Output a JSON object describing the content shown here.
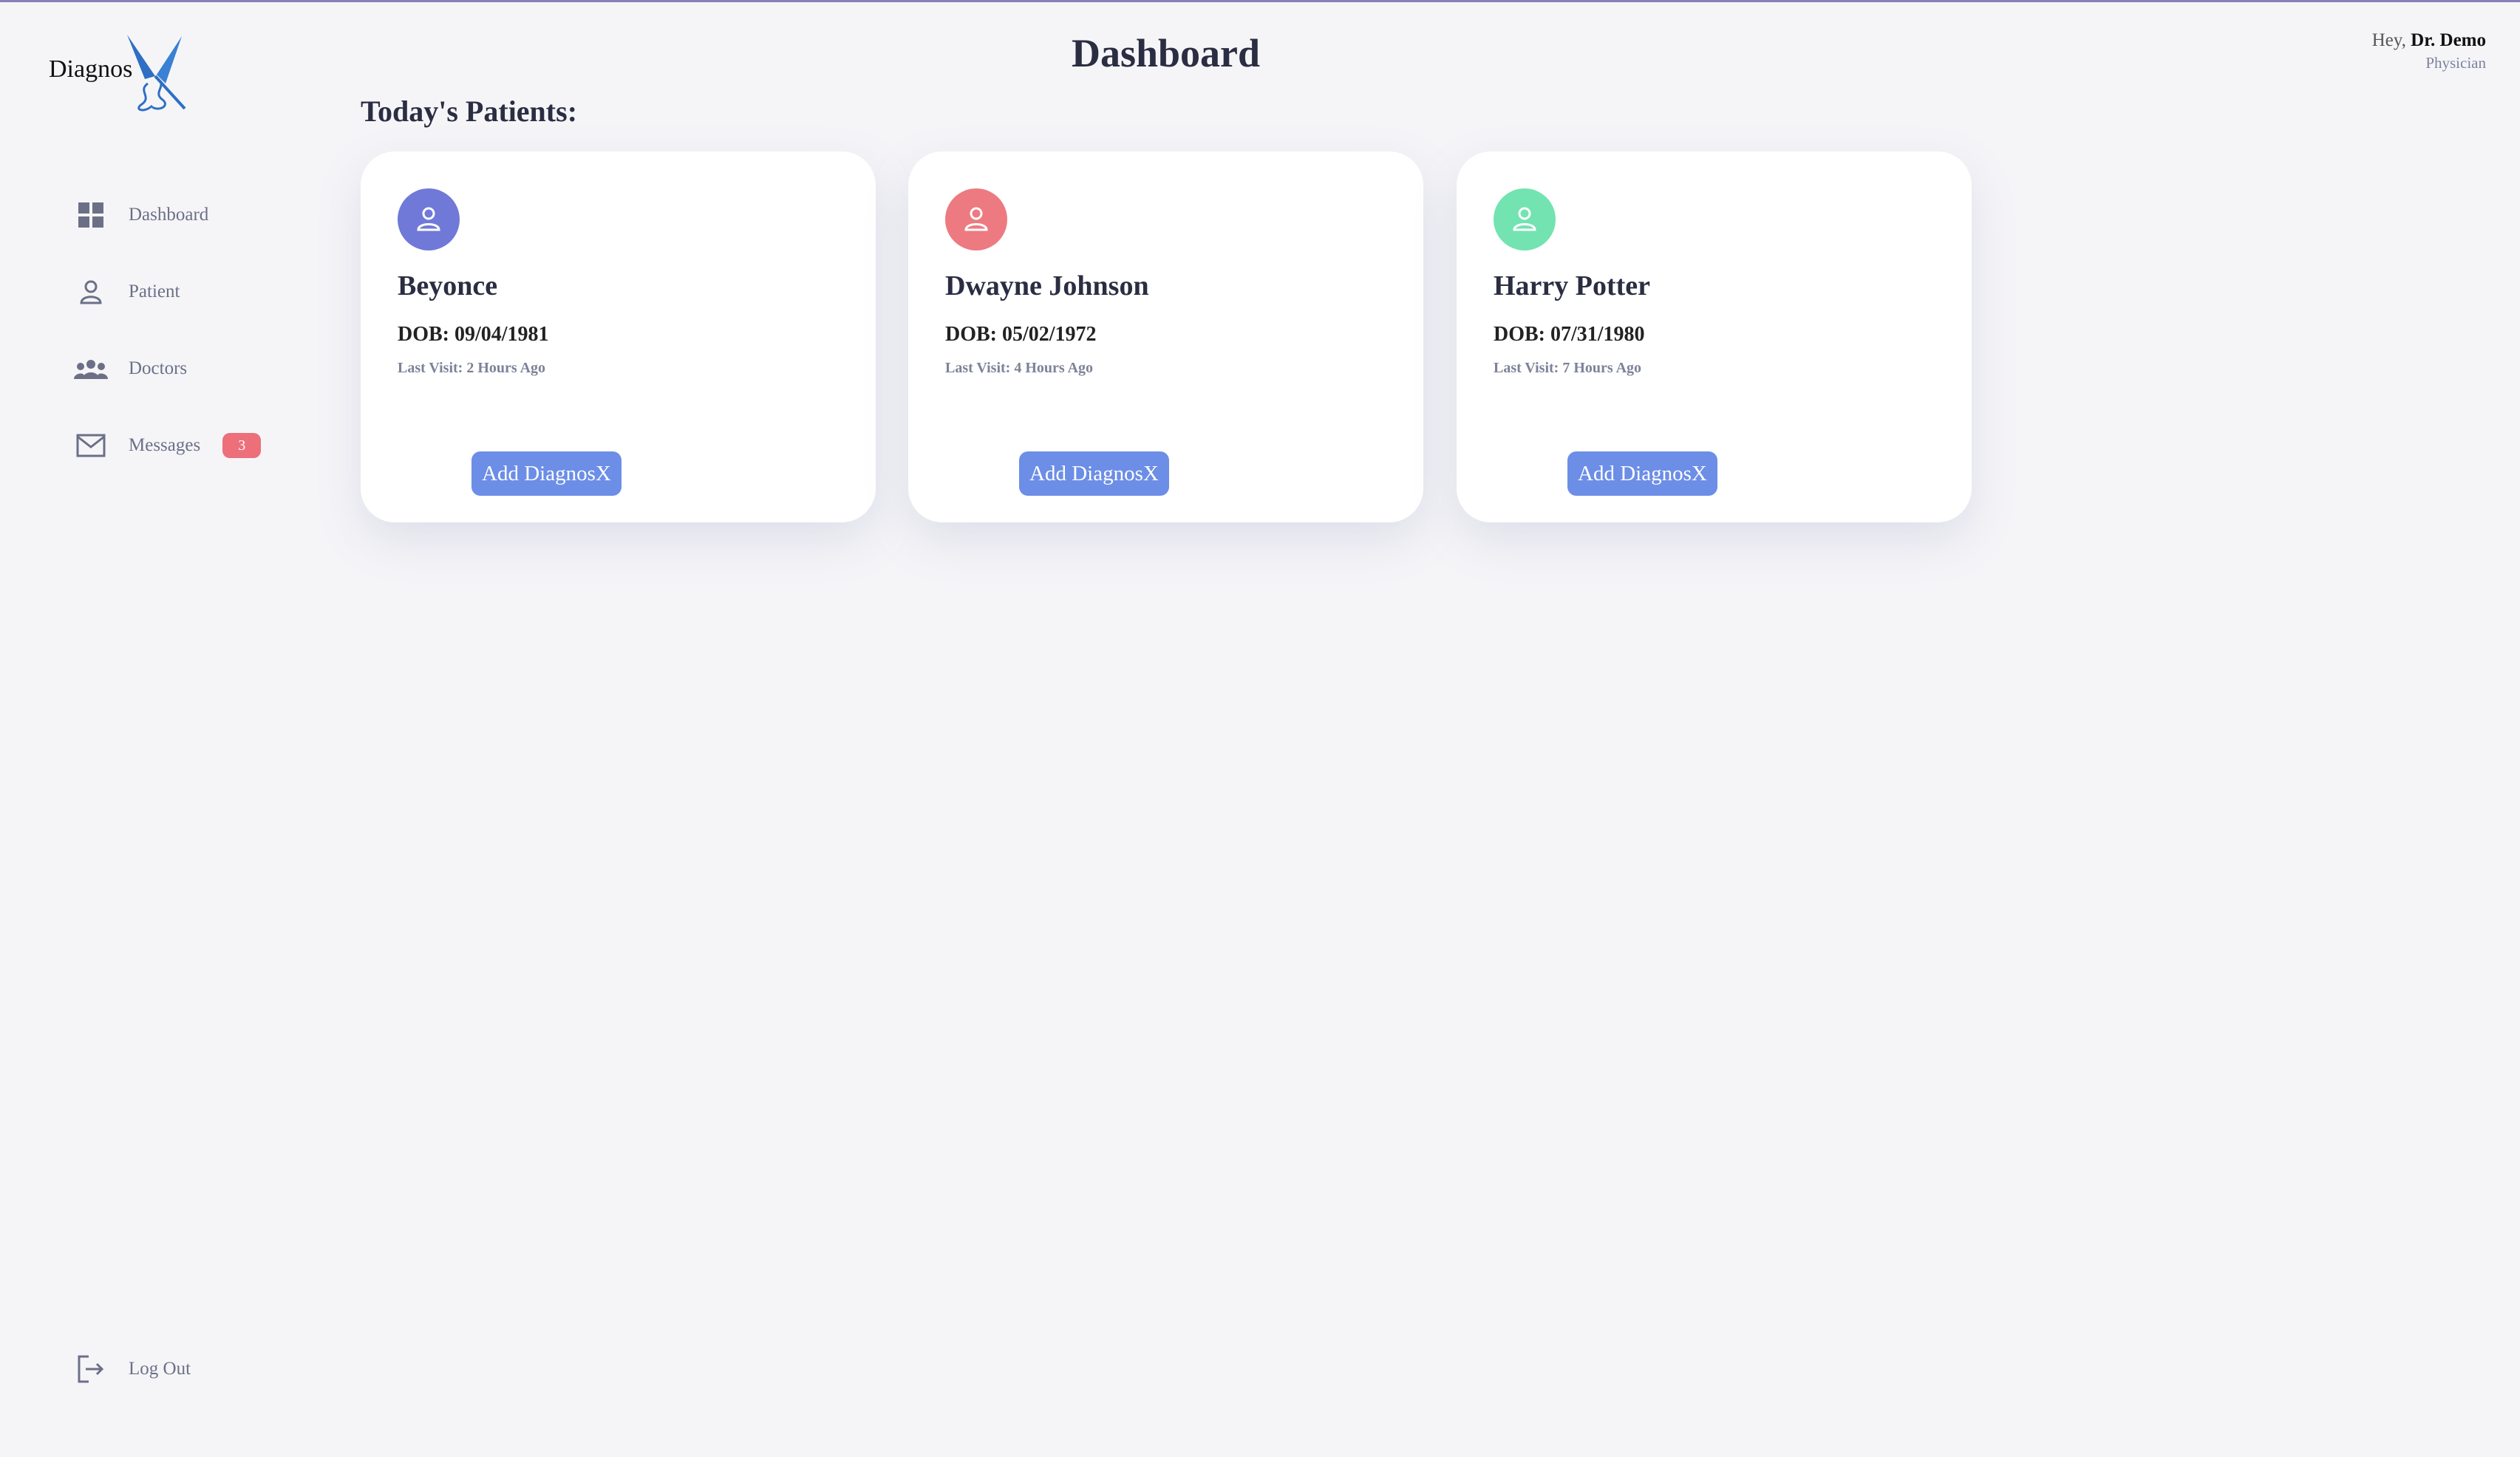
{
  "brand": {
    "name": "Diagnos"
  },
  "header": {
    "title": "Dashboard"
  },
  "user": {
    "greeting": "Hey,",
    "name": "Dr. Demo",
    "role": "Physician"
  },
  "sidebar": {
    "items": [
      {
        "label": "Dashboard",
        "icon": "dashboard-icon"
      },
      {
        "label": "Patient",
        "icon": "person-icon"
      },
      {
        "label": "Doctors",
        "icon": "group-icon"
      },
      {
        "label": "Messages",
        "icon": "mail-icon",
        "badge": "3"
      }
    ],
    "logout": {
      "label": "Log Out",
      "icon": "logout-icon"
    }
  },
  "main": {
    "section_title": "Today's Patients:",
    "patients": [
      {
        "name": "Beyonce",
        "dob": "DOB: 09/04/1981",
        "last_visit": "Last Visit: 2 Hours Ago",
        "button": "Add DiagnosX",
        "color": "#7079d8"
      },
      {
        "name": "Dwayne Johnson",
        "dob": "DOB: 05/02/1972",
        "last_visit": "Last Visit: 4 Hours Ago",
        "button": "Add DiagnosX",
        "color": "#ec7a80"
      },
      {
        "name": "Harry Potter",
        "dob": "DOB: 07/31/1980",
        "last_visit": "Last Visit: 7 Hours Ago",
        "button": "Add DiagnosX",
        "color": "#72e3b1"
      }
    ]
  },
  "colors": {
    "accent": "#6c8ee6",
    "badge": "#ec6f7a",
    "background": "#f5f5f8"
  }
}
